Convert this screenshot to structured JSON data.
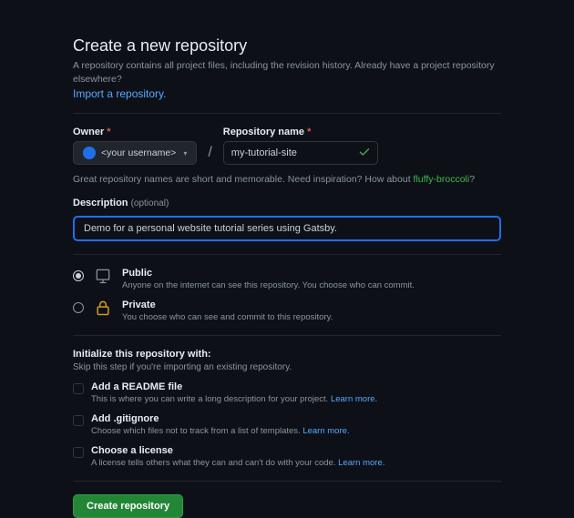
{
  "header": {
    "title": "Create a new repository",
    "subtitle": "A repository contains all project files, including the revision history. Already have a project repository elsewhere?",
    "import_link": "Import a repository."
  },
  "owner": {
    "label": "Owner",
    "value": "<your username>"
  },
  "repo": {
    "label": "Repository name",
    "value": "my-tutorial-site"
  },
  "name_hint": {
    "prefix": "Great repository names are short and memorable. Need inspiration? How about ",
    "suggestion": "fluffy-broccoli",
    "suffix": "?"
  },
  "description": {
    "label": "Description",
    "optional": "(optional)",
    "value": "Demo for a personal website tutorial series using Gatsby."
  },
  "visibility": {
    "public": {
      "title": "Public",
      "desc": "Anyone on the internet can see this repository. You choose who can commit."
    },
    "private": {
      "title": "Private",
      "desc": "You choose who can see and commit to this repository."
    }
  },
  "init": {
    "heading": "Initialize this repository with:",
    "sub": "Skip this step if you're importing an existing repository.",
    "readme": {
      "title": "Add a README file",
      "desc": "This is where you can write a long description for your project. ",
      "learn": "Learn more."
    },
    "gitignore": {
      "title": "Add .gitignore",
      "desc": "Choose which files not to track from a list of templates. ",
      "learn": "Learn more."
    },
    "license": {
      "title": "Choose a license",
      "desc": "A license tells others what they can and can't do with your code. ",
      "learn": "Learn more."
    }
  },
  "submit": {
    "label": "Create repository"
  }
}
